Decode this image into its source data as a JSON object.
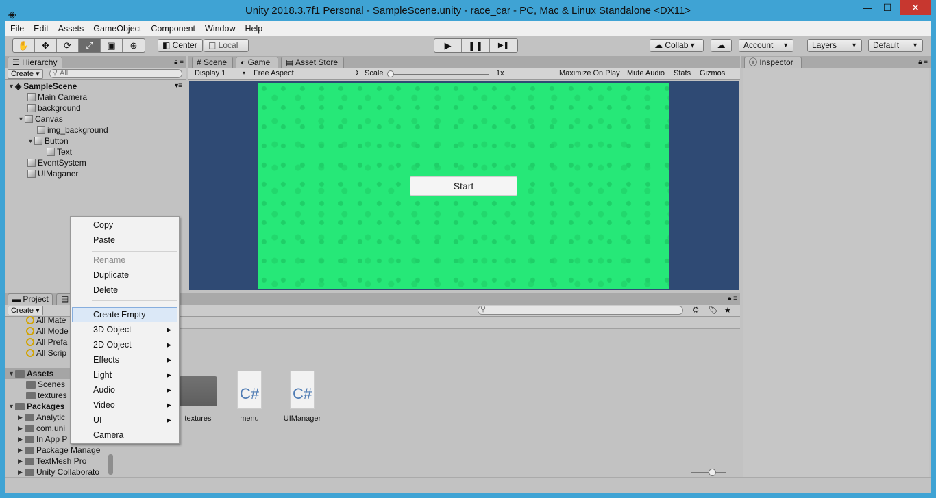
{
  "window": {
    "title": "Unity 2018.3.7f1 Personal - SampleScene.unity - race_car - PC, Mac & Linux Standalone <DX11>",
    "minimize": "—",
    "maximize": "☐",
    "close": "✕"
  },
  "menubar": [
    "File",
    "Edit",
    "Assets",
    "GameObject",
    "Component",
    "Window",
    "Help"
  ],
  "toolbar": {
    "pivot": "Center",
    "space": "Local",
    "collab": "Collab ▾",
    "account": "Account",
    "layers": "Layers",
    "layout": "Default",
    "play": "▶",
    "pause": "❚❚",
    "step": "▶❚"
  },
  "hierarchy": {
    "tab": "Hierarchy",
    "create": "Create ▾",
    "search_placeholder": "All",
    "scene": "SampleScene",
    "items": [
      "Main Camera",
      "background",
      "Canvas",
      "img_background",
      "Button",
      "Text",
      "EventSystem",
      "UIMaganer"
    ]
  },
  "center_tabs": {
    "scene": "Scene",
    "game": "Game",
    "store": "Asset Store"
  },
  "game_bar": {
    "display": "Display 1",
    "aspect": "Free Aspect",
    "scale_label": "Scale",
    "scale_value": "1x",
    "maximize": "Maximize On Play",
    "mute": "Mute Audio",
    "stats": "Stats",
    "gizmos": "Gizmos"
  },
  "game": {
    "start_button": "Start"
  },
  "inspector": {
    "tab": "Inspector"
  },
  "project": {
    "tab": "Project",
    "create": "Create ▾",
    "favorites": [
      "All Mate",
      "All Mode",
      "All Prefa",
      "All Scrip"
    ],
    "assets_label": "Assets",
    "assets_children": [
      "Scenes",
      "textures"
    ],
    "packages_label": "Packages",
    "packages": [
      "Analytic",
      "com.uni",
      "In App P",
      "Package Manage",
      "TextMesh Pro",
      "Unity Collaborato"
    ],
    "files": [
      "textures",
      "menu",
      "UIManager"
    ],
    "cs_glyph": "C#"
  },
  "context_menu": {
    "items": [
      "Copy",
      "Paste",
      "Rename",
      "Duplicate",
      "Delete",
      "Create Empty",
      "3D Object",
      "2D Object",
      "Effects",
      "Light",
      "Audio",
      "Video",
      "UI",
      "Camera"
    ]
  }
}
